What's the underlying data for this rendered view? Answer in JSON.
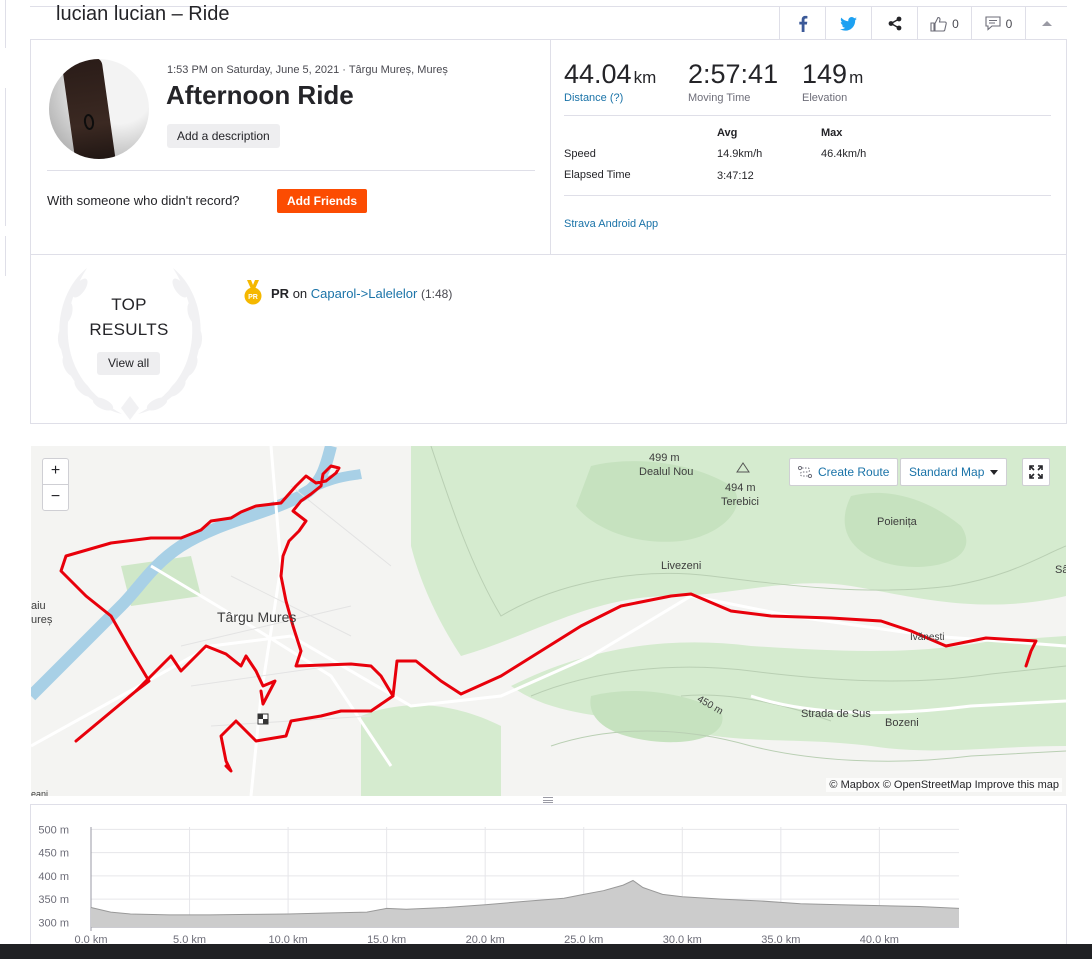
{
  "header": {
    "title": "lucian lucian – Ride",
    "kudos_count": "0",
    "comment_count": "0"
  },
  "activity": {
    "meta": "1:53 PM on Saturday, June 5, 2021 · Târgu Mureș, Mureș",
    "title": "Afternoon Ride",
    "add_description": "Add a description",
    "with_someone": "With someone who didn't record?",
    "add_friends": "Add Friends"
  },
  "stats": {
    "distance": {
      "value": "44.04",
      "unit": "km",
      "label": "Distance (?)"
    },
    "moving_time": {
      "value": "2:57:41",
      "unit": "",
      "label": "Moving Time"
    },
    "elevation": {
      "value": "149",
      "unit": "m",
      "label": "Elevation"
    },
    "table": {
      "head_avg": "Avg",
      "head_max": "Max",
      "speed_label": "Speed",
      "speed_avg": "14.9km/h",
      "speed_max": "46.4km/h",
      "elapsed_label": "Elapsed Time",
      "elapsed_avg": "3:47:12"
    },
    "device": "Strava Android App"
  },
  "top_results": {
    "heading_line1": "TOP",
    "heading_line2": "RESULTS",
    "view_all": "View all",
    "items": [
      {
        "badge": "PR",
        "label": "PR",
        "on": "on",
        "segment": "Caparol->Lalelelor",
        "time": "(1:48)"
      }
    ]
  },
  "map": {
    "create_route": "Create Route",
    "map_type": "Standard Map",
    "zoom_in": "+",
    "zoom_out": "−",
    "attribution": "© Mapbox © OpenStreetMap Improve this map",
    "labels": {
      "city": "Târgu Mureș",
      "dealul_nou_height": "499 m",
      "dealul_nou": "Dealul Nou",
      "terebici_height": "494 m",
      "terebici": "Terebici",
      "poienita": "Poienița",
      "livezeni": "Livezeni",
      "ivanesti": "Ivănești",
      "bozeni": "Bozeni",
      "strada_de_sus": "Strada de Sus",
      "contour_450": "450 m",
      "edge_sa": "Sâ",
      "edge_left_1": "aiu",
      "edge_left_2": "ureș",
      "edge_bottom": "eani"
    },
    "route_color": "#e8000b"
  },
  "chart_data": {
    "type": "area",
    "title": "",
    "xlabel": "",
    "ylabel": "",
    "x": [
      0,
      1,
      2,
      4,
      6,
      8,
      10,
      12,
      14,
      15,
      16,
      18,
      20,
      22,
      24,
      25,
      26,
      27,
      27.5,
      28,
      29,
      30,
      32,
      34,
      36,
      38,
      40,
      42,
      44.04
    ],
    "y": [
      332,
      322,
      318,
      316,
      316,
      317,
      318,
      320,
      322,
      330,
      328,
      332,
      338,
      345,
      352,
      360,
      368,
      380,
      390,
      375,
      360,
      355,
      350,
      346,
      340,
      338,
      336,
      334,
      330
    ],
    "xlim": [
      0,
      44.04
    ],
    "ylim": [
      290,
      505
    ],
    "x_ticks": [
      "0.0 km",
      "5.0 km",
      "10.0 km",
      "15.0 km",
      "20.0 km",
      "25.0 km",
      "30.0 km",
      "35.0 km",
      "40.0 km"
    ],
    "x_tick_values": [
      0,
      5,
      10,
      15,
      20,
      25,
      30,
      35,
      40
    ],
    "y_ticks": [
      "500 m",
      "450 m",
      "400 m",
      "350 m",
      "300 m"
    ],
    "y_tick_values": [
      500,
      450,
      400,
      350,
      300
    ],
    "grid": true,
    "fill_color": "#cccccc",
    "line_color": "#999999"
  }
}
